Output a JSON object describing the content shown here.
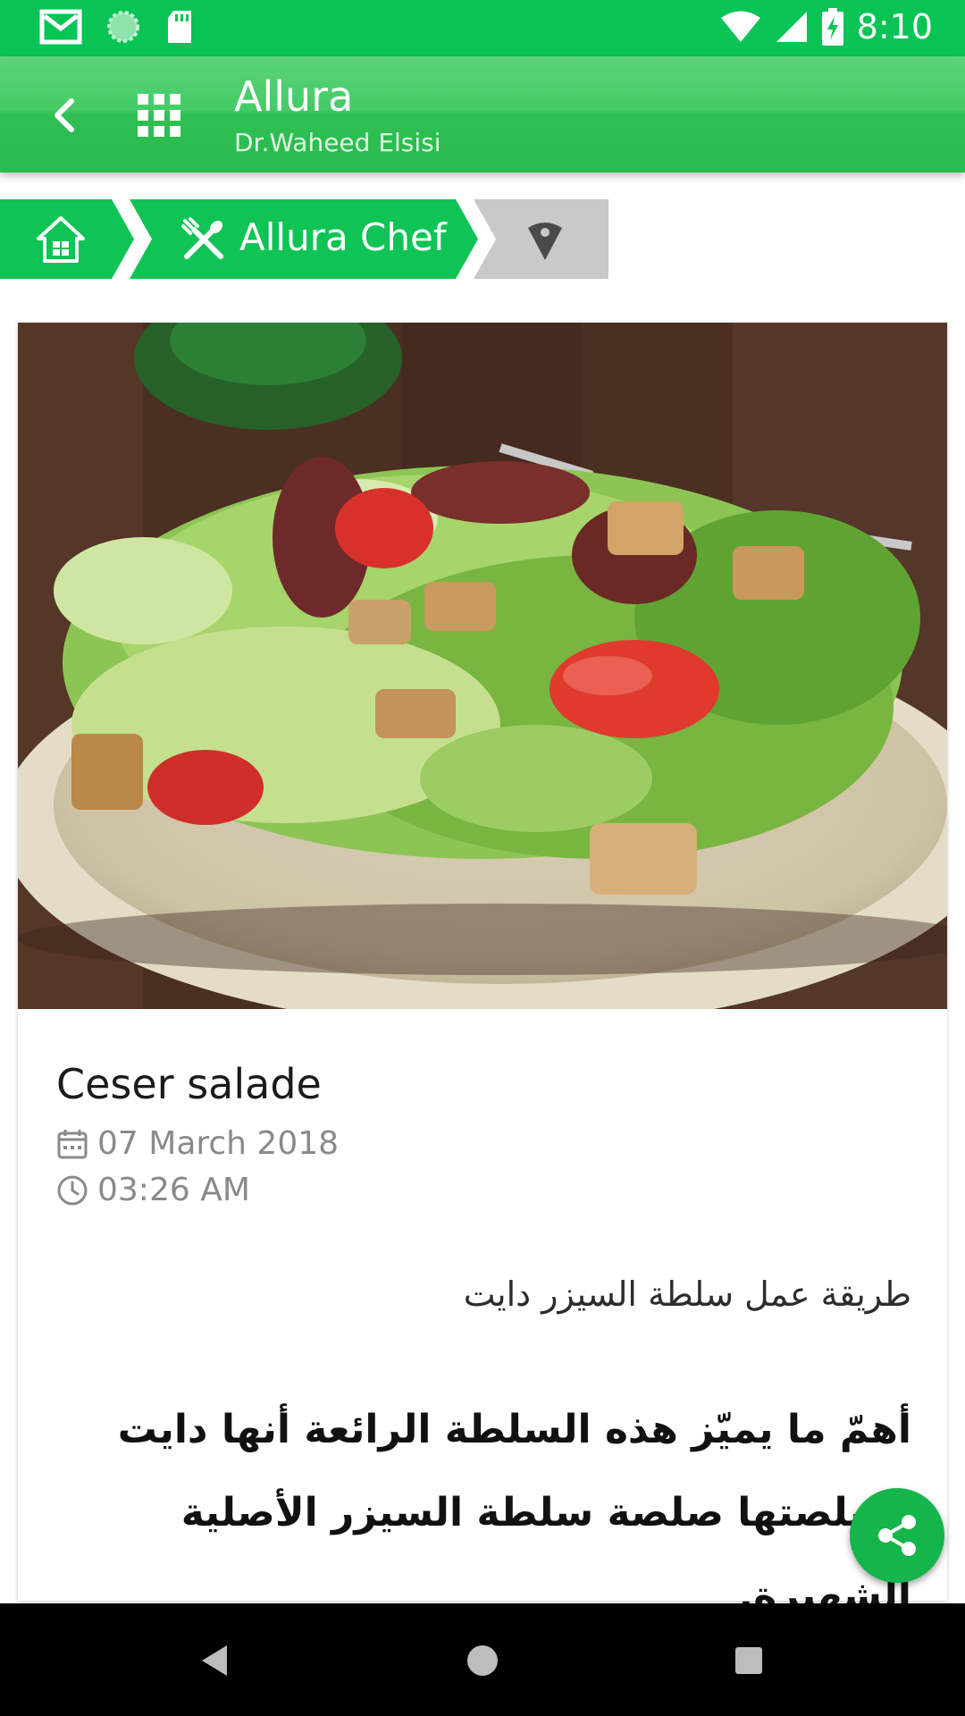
{
  "status_bar": {
    "time": "8:10",
    "left_icons": [
      "gmail-icon",
      "sync-icon",
      "sd-card-icon"
    ],
    "right_icons": [
      "wifi-icon",
      "signal-icon",
      "battery-charging-icon"
    ]
  },
  "app_bar": {
    "title": "Allura",
    "subtitle": "Dr.Waheed Elsisi",
    "color": "#2fbf53"
  },
  "breadcrumb": {
    "items": [
      {
        "icon": "home-icon",
        "label": ""
      },
      {
        "icon": "utensils-icon",
        "label": "Allura Chef"
      },
      {
        "icon": "tag-icon",
        "label": ""
      }
    ],
    "active_color": "#0fc455",
    "inactive_color": "#c9c9c9"
  },
  "article": {
    "image": "caesar-salad-photo",
    "title": "Ceser salade",
    "date": "07 March 2018",
    "time": "03:26 AM",
    "subtitle_ar": "طريقة عمل سلطة السيزر دايت",
    "body_ar": "أهمّ ما يميّز هذه السلطة الرائعة أنها دايت وصلصتها صلصة سلطة السيزر الأصلية الشهيرة."
  },
  "fab": {
    "icon": "share-icon",
    "color": "#14b54a"
  },
  "nav_bar": {
    "buttons": [
      "back-nav-icon",
      "home-nav-icon",
      "recents-nav-icon"
    ]
  }
}
